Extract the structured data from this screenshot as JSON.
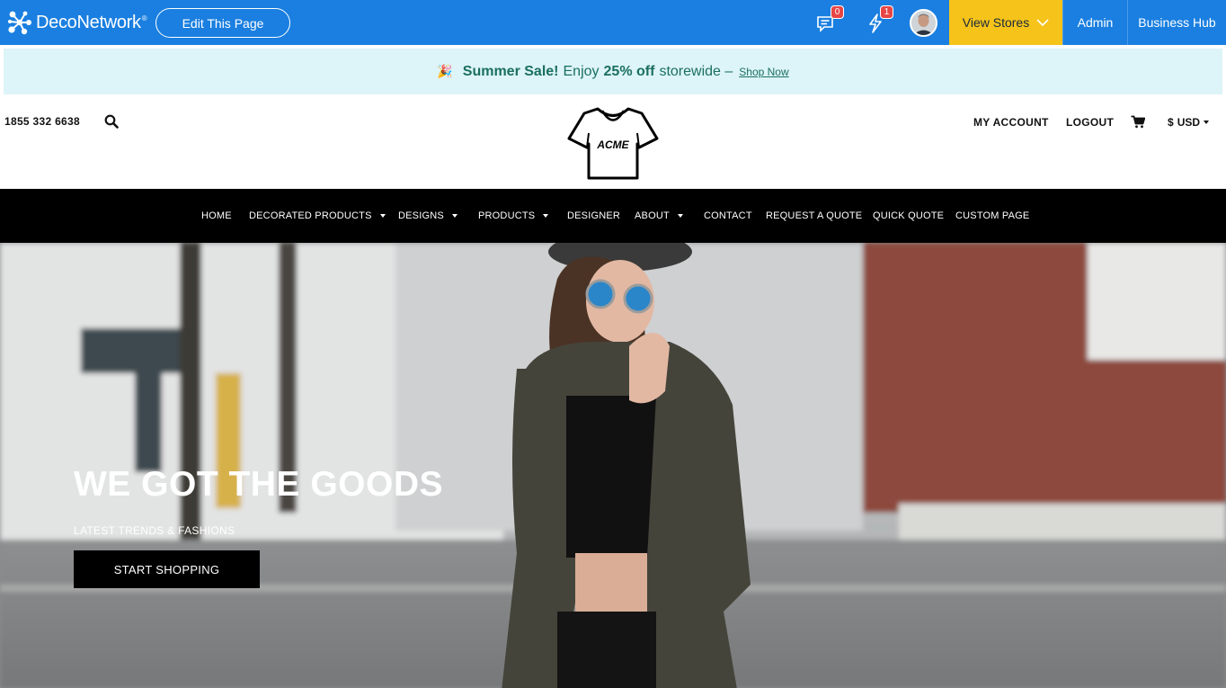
{
  "adminbar": {
    "brand": "DecoNetwork",
    "trademark": "®",
    "edit_button": "Edit This Page",
    "messages_count": "0",
    "notifications_count": "1",
    "view_stores": "View Stores",
    "admin": "Admin",
    "business_hub": "Business Hub",
    "icons": [
      "deconetwork-logo-icon",
      "chat-icon",
      "lightning-icon",
      "user-avatar",
      "chevron-down-icon"
    ],
    "colors": {
      "bar": "#1a7fe0",
      "view_stores_bg": "#f5c31a",
      "badge": "#e84545"
    }
  },
  "promo": {
    "emoji": "🎉",
    "sale": "Summer Sale!",
    "enjoy": "Enjoy",
    "discount": "25% off",
    "rest": "storewide –",
    "link": "Shop Now",
    "colors": {
      "bg": "#ddf4f8",
      "text": "#1a6f60"
    }
  },
  "header": {
    "phone": "1855 332 6638",
    "logo_text": "ACME",
    "my_account": "MY ACCOUNT",
    "logout": "LOGOUT",
    "currency_symbol": "$",
    "currency": "USD",
    "icons": [
      "search-icon",
      "acme-tshirt-logo",
      "cart-icon",
      "caret-down-icon"
    ]
  },
  "nav": {
    "items": [
      {
        "label": "HOME",
        "dropdown": false
      },
      {
        "label": "DECORATED PRODUCTS",
        "dropdown": true
      },
      {
        "label": "DESIGNS",
        "dropdown": true
      },
      {
        "label": "PRODUCTS",
        "dropdown": true
      },
      {
        "label": "DESIGNER",
        "dropdown": false
      },
      {
        "label": "ABOUT",
        "dropdown": true
      },
      {
        "label": "CONTACT",
        "dropdown": false
      },
      {
        "label": "REQUEST A QUOTE",
        "dropdown": false
      },
      {
        "label": "QUICK QUOTE",
        "dropdown": false
      },
      {
        "label": "CUSTOM PAGE",
        "dropdown": false
      }
    ]
  },
  "hero": {
    "title": "WE GOT THE GOODS",
    "subtitle": "LATEST TRENDS & FASHIONS",
    "button": "START SHOPPING",
    "image": "woman-in-hat-and-sunglasses-photo"
  }
}
